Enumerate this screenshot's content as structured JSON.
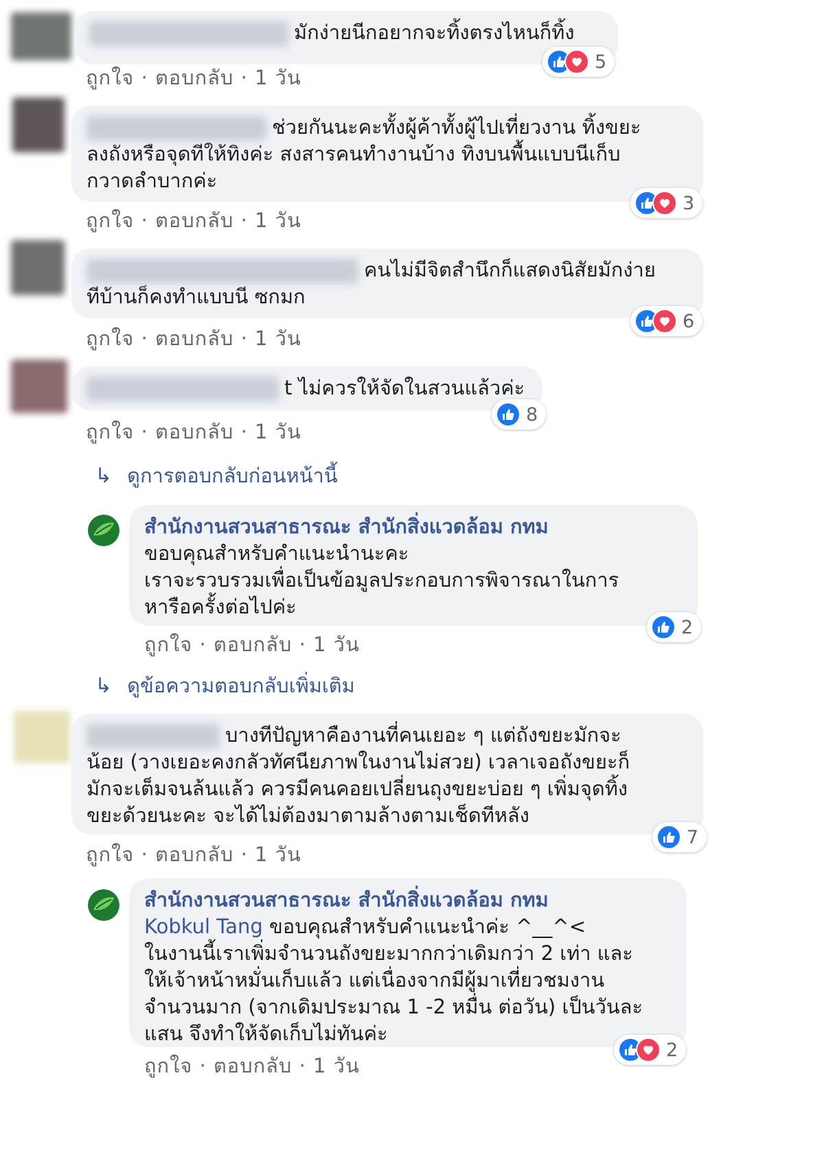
{
  "common": {
    "like": "ถูกใจ",
    "reply": "ตอบกลับ",
    "time": "1 วัน",
    "sep": "·"
  },
  "comments": [
    {
      "text": "มักง่ายนีกอยากจะทิ้งตรงไหนก็ทิ้ง",
      "reactions": "5"
    },
    {
      "text_line1": "ช่วยกันนะคะทั้งผู้ค้าทั้งผู้ไปเที่ยวงาน ทิ้งขยะ",
      "text_line2": "ลงถังหรือจุดทีให้ทิงค่ะ สงสารคนทำงานบ้าง ทิงบนพื้นแบบนีเก็บ",
      "text_line3": "กวาดลำบากค่ะ",
      "reactions": "3"
    },
    {
      "text_line1": "คนไม่มีจิตสำนึกก็แสดงนิสัยมักง่าย",
      "text_line2": "ทีบ้านก็คงทำแบบนี ซกมก",
      "reactions": "6"
    },
    {
      "text": "t ไม่ควรให้จัดในสวนแล้วค่ะ",
      "reactions": "8"
    },
    {
      "text_line1": "บางทีปัญหาคืองานที่คนเยอะ ๆ แต่ถังขยะมักจะ",
      "text_line2": "น้อย (วางเยอะคงกลัวทัศนียภาพในงานไม่สวย) เวลาเจอถังขยะก็",
      "text_line3": "มักจะเต็มจนล้นแล้ว ควรมีคนคอยเปลี่ยนถุงขยะบ่อย ๆ เพิ่มจุดทิ้ง",
      "text_line4": "ขยะด้วยนะคะ จะได้ไม่ต้องมาตามล้างตามเช็ดทีหลัง",
      "reactions": "7"
    }
  ],
  "view_previous": "ดูการตอบกลับก่อนหน้านี้",
  "view_more": "ดูข้อความตอบกลับเพิ่มเติม",
  "reply1": {
    "author": "สำนักงานสวนสาธารณะ สำนักสิ่งแวดล้อม กทม",
    "line1": "ขอบคุณสำหรับคำแนะนำนะคะ",
    "line2": "เราจะรวบรวมเพื่อเป็นข้อมูลประกอบการพิจารณาในการ",
    "line3": "หารือครั้งต่อไปค่ะ",
    "reactions": "2"
  },
  "reply2": {
    "author": "สำนักงานสวนสาธารณะ สำนักสิ่งแวดล้อม กทม",
    "mention": "Kobkul Tang",
    "line1": "ขอบคุณสำหรับคำแนะนำค่ะ ^__^<",
    "line2": "ในงานนี้เราเพิ่มจำนวนถังขยะมากกว่าเดิมกว่า 2 เท่า และ",
    "line3": "ให้เจ้าหน้าหมั่นเก็บแล้ว แต่เนื่องจากมีผู้มาเที่ยวชมงาน",
    "line4": "จำนวนมาก (จากเดิมประมาณ 1 -2 หมื่น ต่อวัน) เป็นวันละ",
    "line5": "แสน จึงทำให้จัดเก็บไม่ทันค่ะ",
    "reactions": "2"
  },
  "colors": {
    "like": "#1877f2",
    "love": "#f33e58",
    "link": "#385898",
    "bubble": "#f0f2f5"
  }
}
